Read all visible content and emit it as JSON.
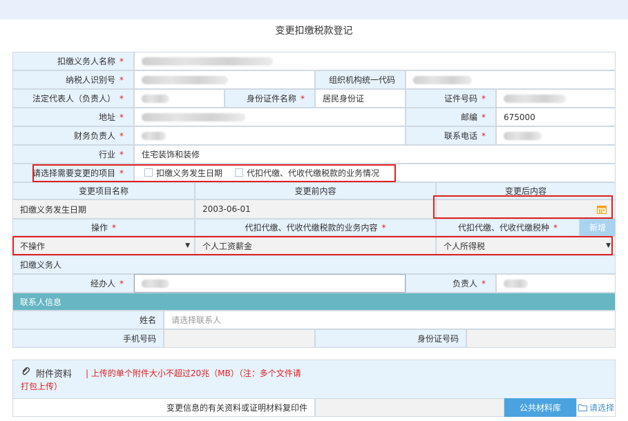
{
  "form": {
    "title": "变更扣缴税款登记",
    "withholder_name_label": "扣缴义务人名称",
    "taxpayer_id_label": "纳税人识别号",
    "org_code_label": "组织机构统一代码",
    "legal_rep_label": "法定代表人（负责人）",
    "id_type_label": "身份证件名称",
    "id_type_value": "居民身份证",
    "id_number_label": "证件号码",
    "address_label": "地址",
    "postcode_label": "邮编",
    "postcode_value": "675000",
    "finance_head_label": "财务负责人",
    "phone_label": "联系电话",
    "industry_label": "行业",
    "industry_value": "住宅装饰和装修",
    "change_select_label": "请选择需要变更的项目",
    "change_options": [
      "扣缴义务发生日期",
      "代扣代缴、代收代缴税款的业务情况"
    ],
    "required_mark": "*"
  },
  "change_table": {
    "headers": [
      "变更项目名称",
      "变更前内容",
      "变更后内容"
    ],
    "row_item": "扣缴义务发生日期",
    "row_before": "2003-06-01",
    "row_after": ""
  },
  "ops_table": {
    "headers": [
      "操作",
      "代扣代缴、代收代缴税款的业务内容",
      "代扣代缴、代收代缴税种"
    ],
    "add_button": "新增",
    "operation_value": "不操作",
    "content_value": "个人工资薪金",
    "tax_type_value": "个人所得税"
  },
  "agent": {
    "section_label": "扣缴义务人",
    "handler_label": "经办人",
    "responsible_label": "负责人"
  },
  "contact": {
    "section_label": "联系人信息",
    "name_label": "姓名",
    "name_placeholder": "请选择联系人",
    "mobile_label": "手机号码",
    "idno_label": "身份证号码"
  },
  "attachments": {
    "title": "附件资料",
    "note_line1": "| 上传的单个附件大小不超过20兆（MB）（注：多个文件请",
    "note_line2": "打包上传）",
    "material_label": "变更信息的有关资料或证明材料复印件",
    "library_button": "公共材料库",
    "select_button": "请选择"
  },
  "colors": {
    "label_bg": "#e6f2fc",
    "section_bg": "#66b6c3",
    "button_bg": "#4aa3df",
    "highlight": "#e02020"
  }
}
